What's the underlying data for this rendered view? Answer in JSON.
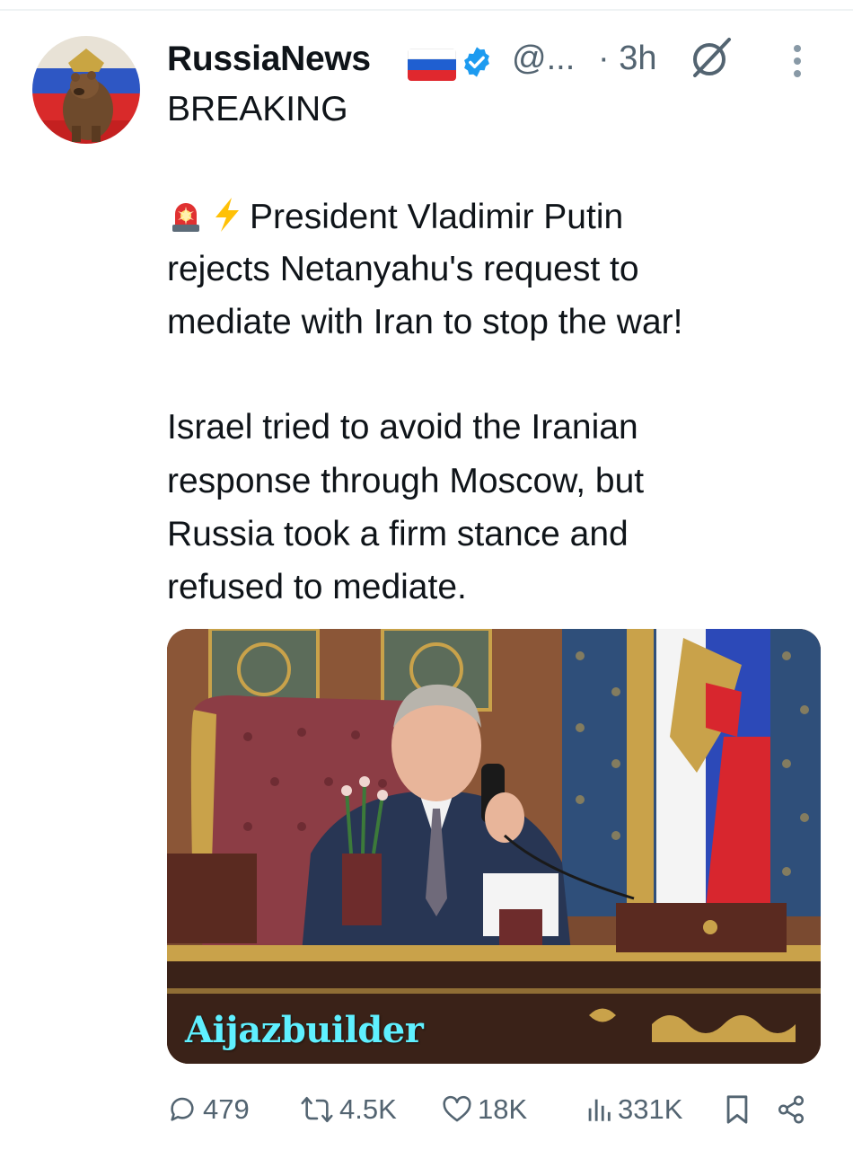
{
  "post": {
    "author_name": "RussiaNews",
    "handle": "@...",
    "time": "· 3h",
    "headline": "BREAKING",
    "text_line_1": "President Vladimir Putin",
    "text_line_2": "rejects Netanyahu's request to",
    "text_line_3": "mediate with Iran to stop the war!",
    "text_line_4": "Israel tried to avoid the Iranian",
    "text_line_5": "response through Moscow, but",
    "text_line_6": "Russia took a firm stance and",
    "text_line_7": "refused to mediate.",
    "media_watermark": "Aijazbuilder"
  },
  "actions": {
    "replies": "479",
    "reposts": "4.5K",
    "likes": "18K",
    "views": "331K"
  },
  "icons": {
    "avatar": "bear-flag-avatar",
    "flag": "russia-flag-emoji",
    "verified": "verified-badge-icon",
    "grok": "grok-icon",
    "more": "more-vertical-icon",
    "emoji_1": "police-light-emoji",
    "emoji_2": "lightning-emoji",
    "reply": "reply-icon",
    "repost": "repost-icon",
    "like": "heart-icon",
    "views": "views-icon",
    "bookmark": "bookmark-icon",
    "share": "share-icon"
  },
  "colors": {
    "text": "#0f1419",
    "secondary": "#536471",
    "verified_blue": "#1d9bf0",
    "watermark": "#5ff0ff"
  }
}
